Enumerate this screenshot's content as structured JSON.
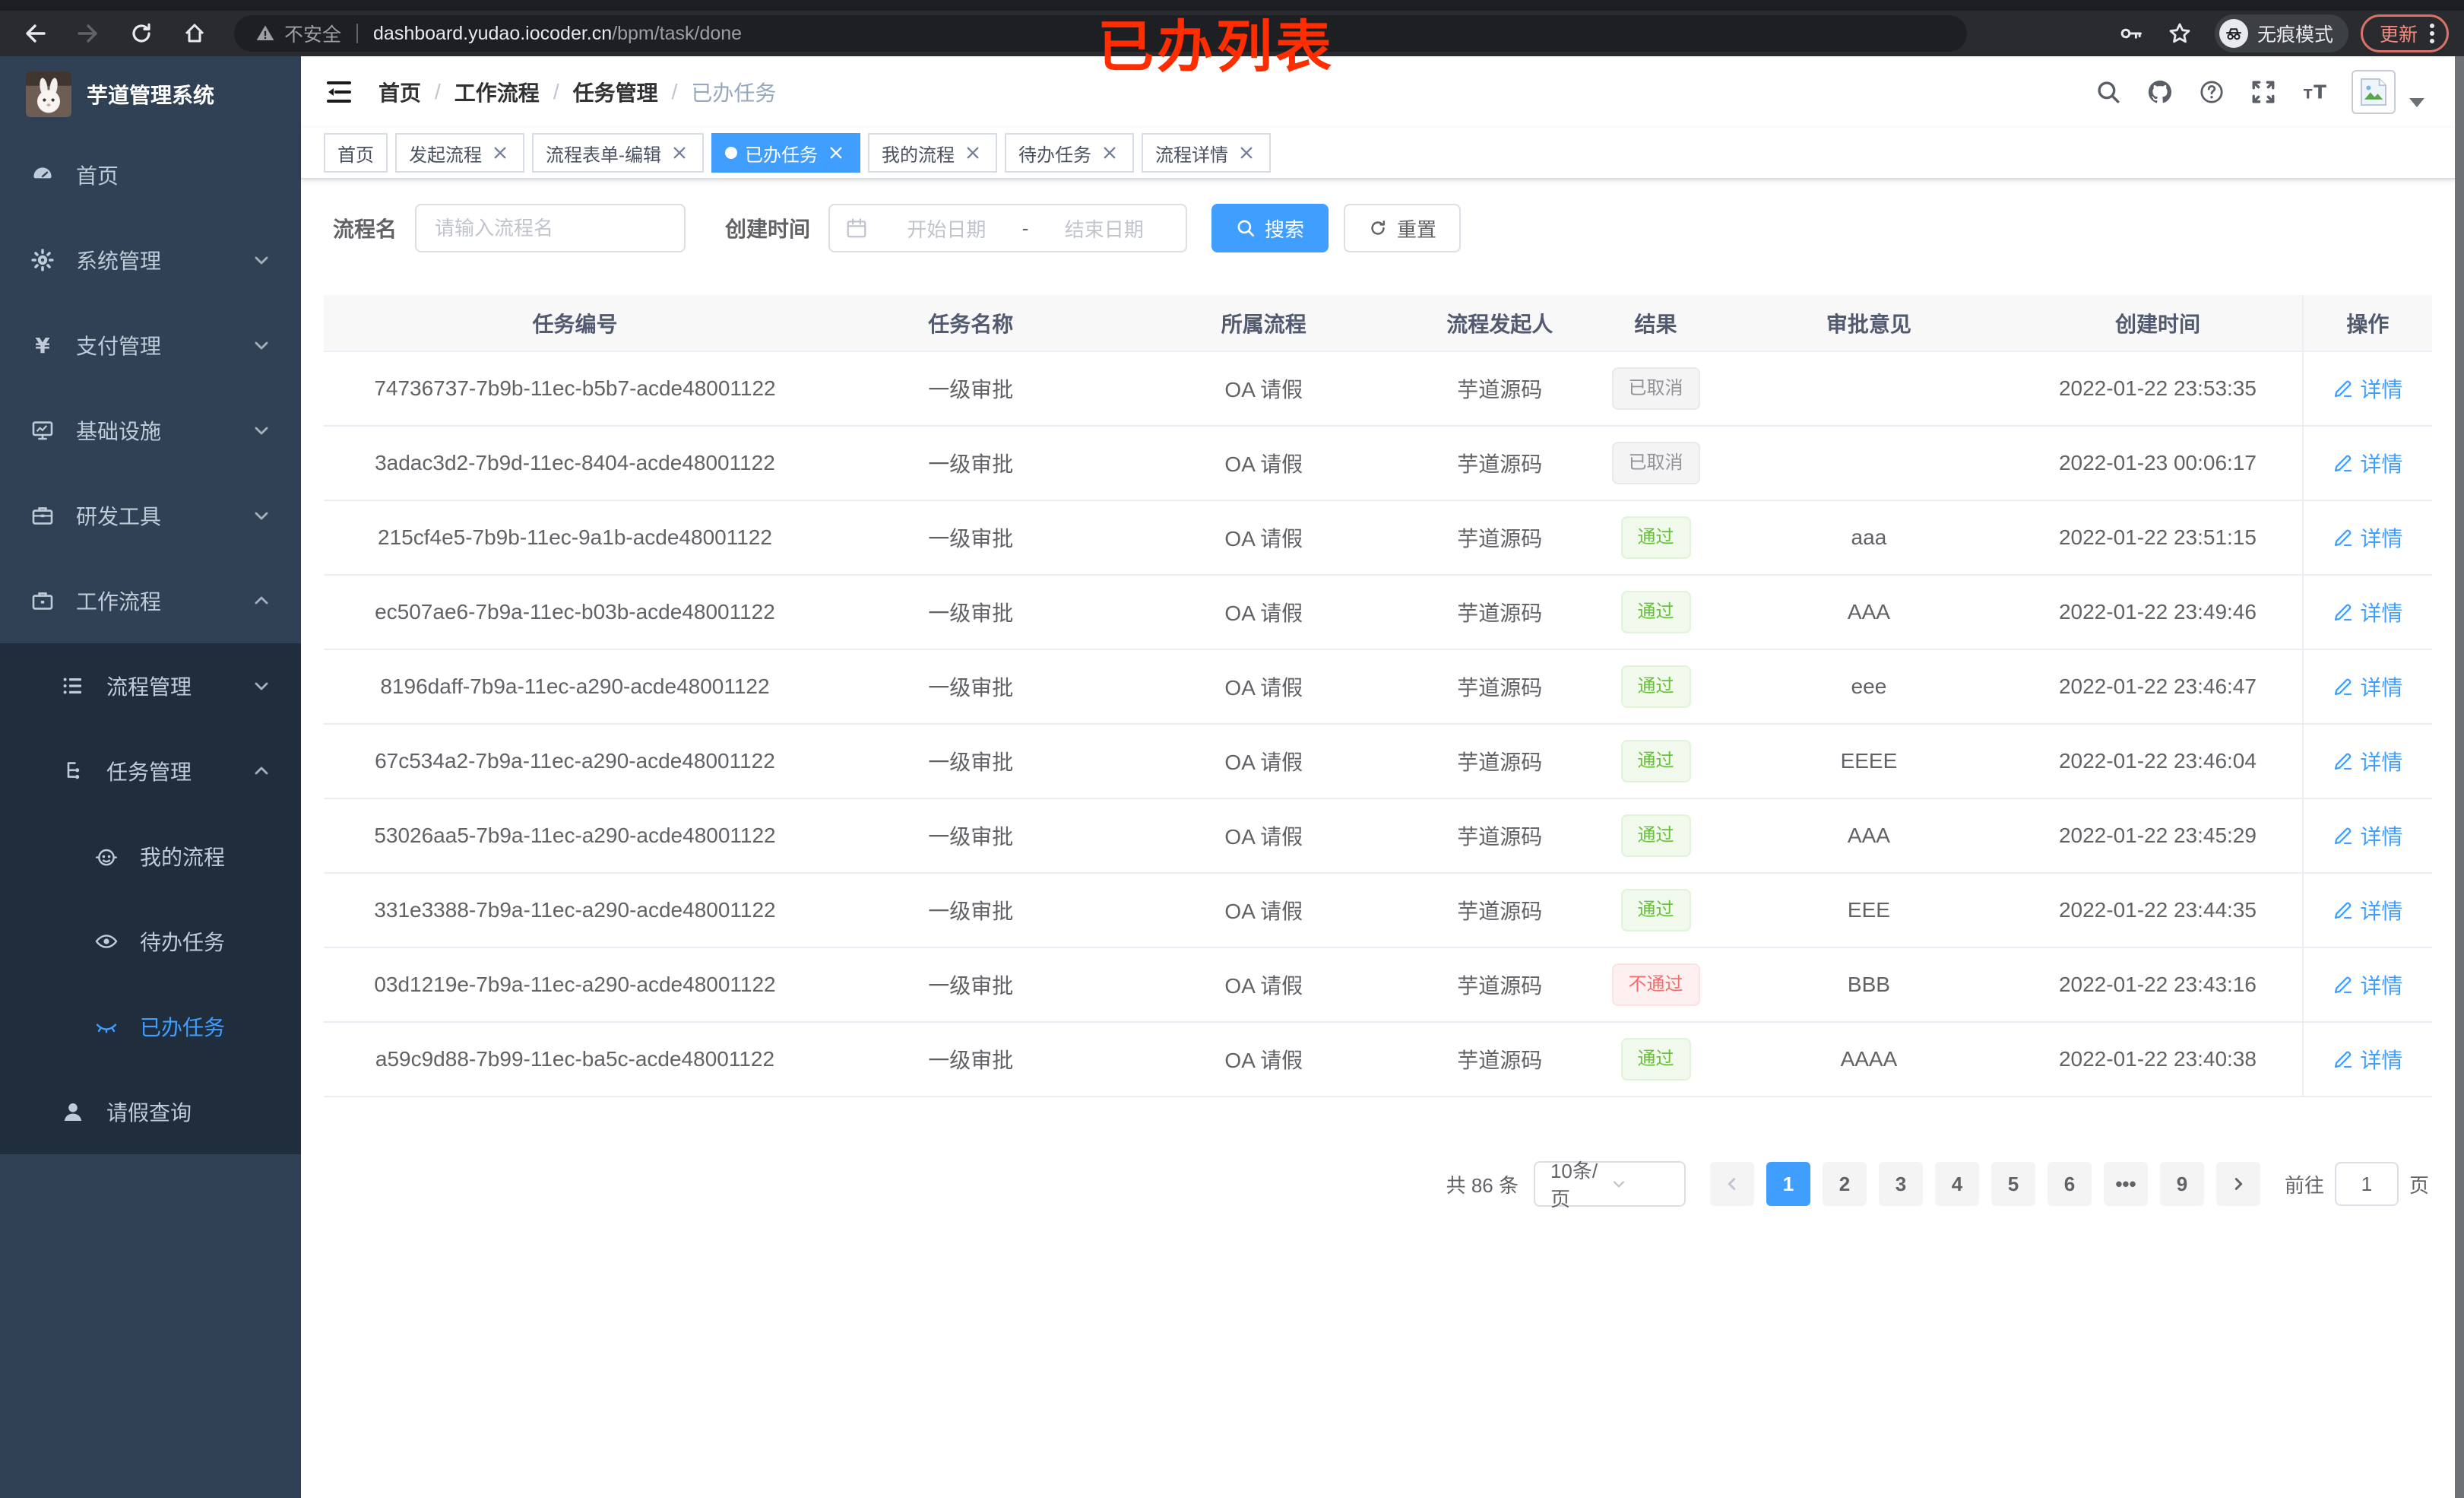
{
  "browser": {
    "security_label": "不安全",
    "url_host": "dashboard.yudao.iocoder.cn",
    "url_path": "/bpm/task/done",
    "incognito_label": "无痕模式",
    "update_label": "更新"
  },
  "annotation": {
    "text": "已办列表",
    "color": "#ff2d00"
  },
  "sidebar": {
    "title": "芋道管理系统",
    "items": [
      {
        "label": "首页"
      },
      {
        "label": "系统管理"
      },
      {
        "label": "支付管理"
      },
      {
        "label": "基础设施"
      },
      {
        "label": "研发工具"
      },
      {
        "label": "工作流程"
      },
      {
        "label": "流程管理"
      },
      {
        "label": "任务管理"
      },
      {
        "label": "我的流程"
      },
      {
        "label": "待办任务"
      },
      {
        "label": "已办任务"
      },
      {
        "label": "请假查询"
      }
    ]
  },
  "breadcrumb": {
    "separator": "/",
    "items": [
      "首页",
      "工作流程",
      "任务管理",
      "已办任务"
    ]
  },
  "tabs": [
    {
      "label": "首页",
      "closable": false,
      "active": false
    },
    {
      "label": "发起流程",
      "closable": true,
      "active": false
    },
    {
      "label": "流程表单-编辑",
      "closable": true,
      "active": false
    },
    {
      "label": "已办任务",
      "closable": true,
      "active": true
    },
    {
      "label": "我的流程",
      "closable": true,
      "active": false
    },
    {
      "label": "待办任务",
      "closable": true,
      "active": false
    },
    {
      "label": "流程详情",
      "closable": true,
      "active": false
    }
  ],
  "filters": {
    "name_label": "流程名",
    "name_placeholder": "请输入流程名",
    "time_label": "创建时间",
    "start_placeholder": "开始日期",
    "separator": "-",
    "end_placeholder": "结束日期",
    "search_label": "搜索",
    "reset_label": "重置"
  },
  "table": {
    "columns": [
      "任务编号",
      "任务名称",
      "所属流程",
      "流程发起人",
      "结果",
      "审批意见",
      "创建时间",
      "操作"
    ],
    "rows": [
      {
        "id": "74736737-7b9b-11ec-b5b7-acde48001122",
        "name": "一级审批",
        "process": "OA 请假",
        "starter": "芋道源码",
        "result": "已取消",
        "result_type": "info",
        "comment": "",
        "created": "2022-01-22 23:53:35",
        "action": "详情"
      },
      {
        "id": "3adac3d2-7b9d-11ec-8404-acde48001122",
        "name": "一级审批",
        "process": "OA 请假",
        "starter": "芋道源码",
        "result": "已取消",
        "result_type": "info",
        "comment": "",
        "created": "2022-01-23 00:06:17",
        "action": "详情"
      },
      {
        "id": "215cf4e5-7b9b-11ec-9a1b-acde48001122",
        "name": "一级审批",
        "process": "OA 请假",
        "starter": "芋道源码",
        "result": "通过",
        "result_type": "success",
        "comment": "aaa",
        "created": "2022-01-22 23:51:15",
        "action": "详情"
      },
      {
        "id": "ec507ae6-7b9a-11ec-b03b-acde48001122",
        "name": "一级审批",
        "process": "OA 请假",
        "starter": "芋道源码",
        "result": "通过",
        "result_type": "success",
        "comment": "AAA",
        "created": "2022-01-22 23:49:46",
        "action": "详情"
      },
      {
        "id": "8196daff-7b9a-11ec-a290-acde48001122",
        "name": "一级审批",
        "process": "OA 请假",
        "starter": "芋道源码",
        "result": "通过",
        "result_type": "success",
        "comment": "eee",
        "created": "2022-01-22 23:46:47",
        "action": "详情"
      },
      {
        "id": "67c534a2-7b9a-11ec-a290-acde48001122",
        "name": "一级审批",
        "process": "OA 请假",
        "starter": "芋道源码",
        "result": "通过",
        "result_type": "success",
        "comment": "EEEE",
        "created": "2022-01-22 23:46:04",
        "action": "详情"
      },
      {
        "id": "53026aa5-7b9a-11ec-a290-acde48001122",
        "name": "一级审批",
        "process": "OA 请假",
        "starter": "芋道源码",
        "result": "通过",
        "result_type": "success",
        "comment": "AAA",
        "created": "2022-01-22 23:45:29",
        "action": "详情"
      },
      {
        "id": "331e3388-7b9a-11ec-a290-acde48001122",
        "name": "一级审批",
        "process": "OA 请假",
        "starter": "芋道源码",
        "result": "通过",
        "result_type": "success",
        "comment": "EEE",
        "created": "2022-01-22 23:44:35",
        "action": "详情"
      },
      {
        "id": "03d1219e-7b9a-11ec-a290-acde48001122",
        "name": "一级审批",
        "process": "OA 请假",
        "starter": "芋道源码",
        "result": "不通过",
        "result_type": "danger",
        "comment": "BBB",
        "created": "2022-01-22 23:43:16",
        "action": "详情"
      },
      {
        "id": "a59c9d88-7b99-11ec-ba5c-acde48001122",
        "name": "一级审批",
        "process": "OA 请假",
        "starter": "芋道源码",
        "result": "通过",
        "result_type": "success",
        "comment": "AAAA",
        "created": "2022-01-22 23:40:38",
        "action": "详情"
      }
    ]
  },
  "pagination": {
    "total_label": "共 86 条",
    "page_size_label": "10条/页",
    "pages": [
      "1",
      "2",
      "3",
      "4",
      "5",
      "6",
      "•••",
      "9"
    ],
    "active_page": "1",
    "goto_label": "前往",
    "goto_value": "1",
    "page_suffix_label": "页"
  }
}
